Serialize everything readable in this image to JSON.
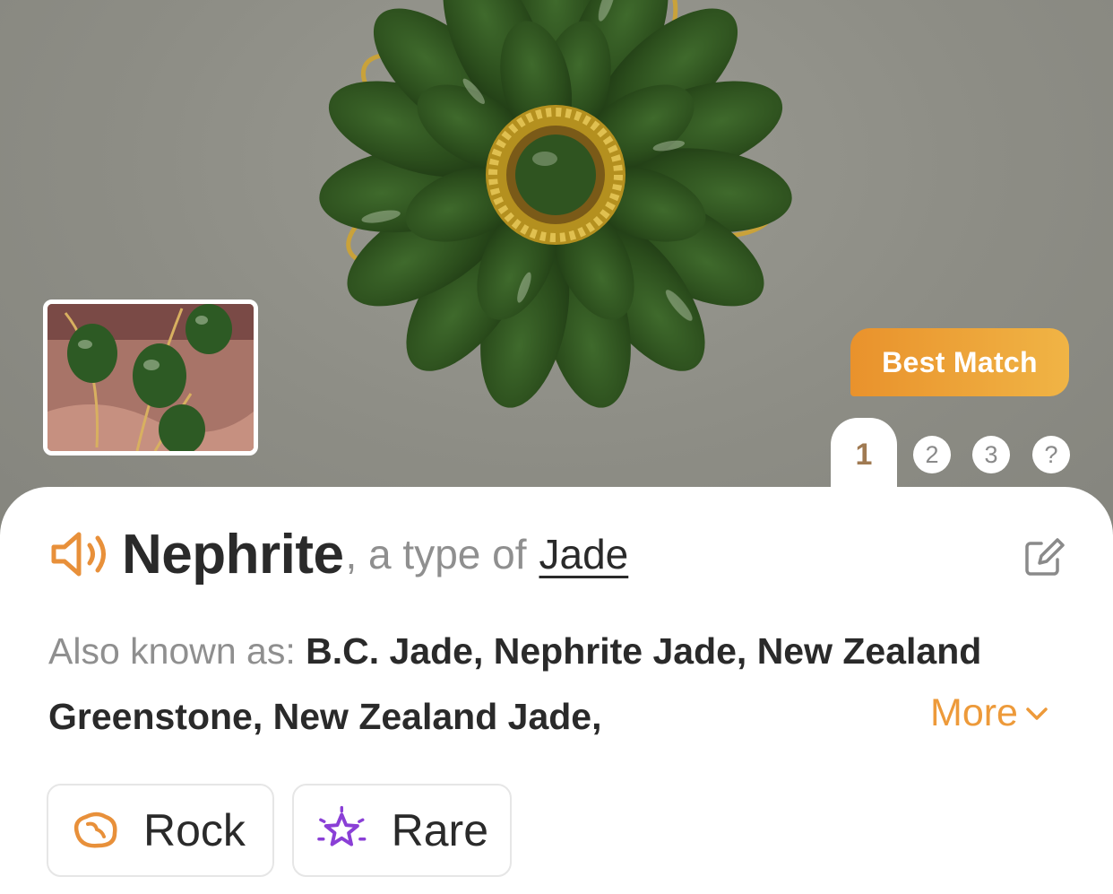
{
  "hero": {
    "badge_label": "Best Match",
    "pages": [
      "1",
      "2",
      "3",
      "?"
    ],
    "active_page": "1"
  },
  "result": {
    "name": "Nephrite",
    "type_prefix": ", a type of",
    "type_link": "Jade",
    "aka_label": "Also known as: ",
    "aka_values": "B.C. Jade, Nephrite Jade, New Zealand Greenstone, New Zealand Jade,",
    "more_label": "More"
  },
  "tags": [
    {
      "label": "Rock",
      "icon": "rock-icon",
      "color": "#e8903a"
    },
    {
      "label": "Rare",
      "icon": "sparkle-star-icon",
      "color": "#8a3fd6"
    }
  ],
  "colors": {
    "accent": "#ed9a3a",
    "badge_gradient_start": "#e9922c",
    "badge_gradient_end": "#f0b445",
    "text": "#2a2a2a",
    "muted": "#8f8f8f"
  }
}
